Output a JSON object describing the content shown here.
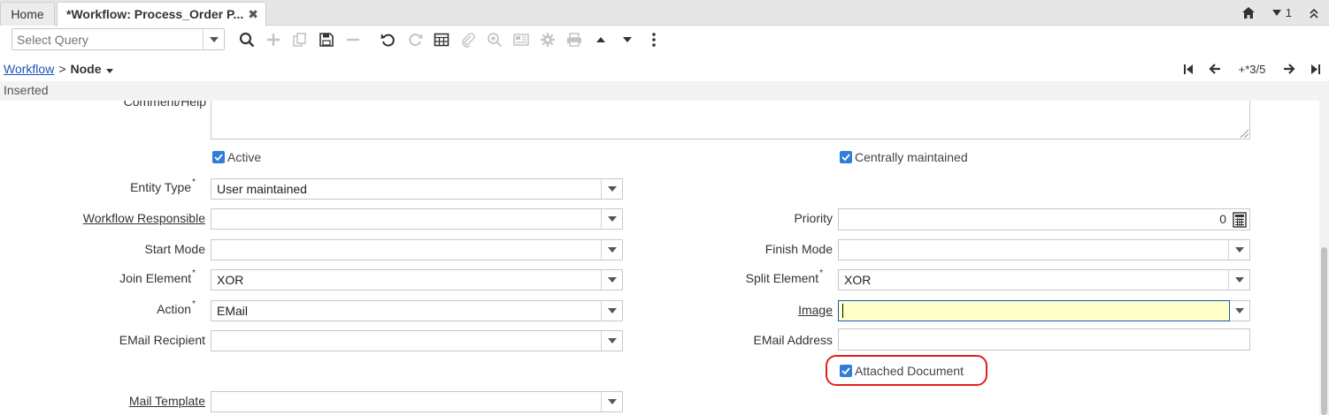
{
  "tabs": {
    "home": "Home",
    "active": "*Workflow: Process_Order P...",
    "close_glyph": "✖"
  },
  "header_right": {
    "notification_count": "1"
  },
  "toolbar": {
    "query_placeholder": "Select Query"
  },
  "breadcrumb": {
    "parent": "Workflow",
    "separator": ">",
    "current": "Node"
  },
  "navigation": {
    "record_count": "+*3/5"
  },
  "status": "Inserted",
  "form": {
    "comment_help_label": "Comment/Help",
    "active_label": "Active",
    "centrally_maintained_label": "Centrally maintained",
    "entity_type": {
      "label": "Entity Type",
      "value": "User maintained"
    },
    "workflow_responsible": {
      "label": "Workflow Responsible",
      "value": ""
    },
    "priority": {
      "label": "Priority",
      "value": "0"
    },
    "start_mode": {
      "label": "Start Mode",
      "value": ""
    },
    "finish_mode": {
      "label": "Finish Mode",
      "value": ""
    },
    "join_element": {
      "label": "Join Element",
      "value": "XOR"
    },
    "split_element": {
      "label": "Split Element",
      "value": "XOR"
    },
    "action": {
      "label": "Action",
      "value": "EMail"
    },
    "image": {
      "label": "Image",
      "value": ""
    },
    "email_recipient": {
      "label": "EMail Recipient",
      "value": ""
    },
    "email_address": {
      "label": "EMail Address",
      "value": ""
    },
    "attached_document_label": "Attached Document",
    "mail_template": {
      "label": "Mail Template",
      "value": ""
    },
    "required_mark": "*"
  },
  "colors": {
    "accent": "#2f7ed8",
    "link": "#1a55b8",
    "focus_bg": "#ffffc8",
    "highlight": "#e02020"
  }
}
